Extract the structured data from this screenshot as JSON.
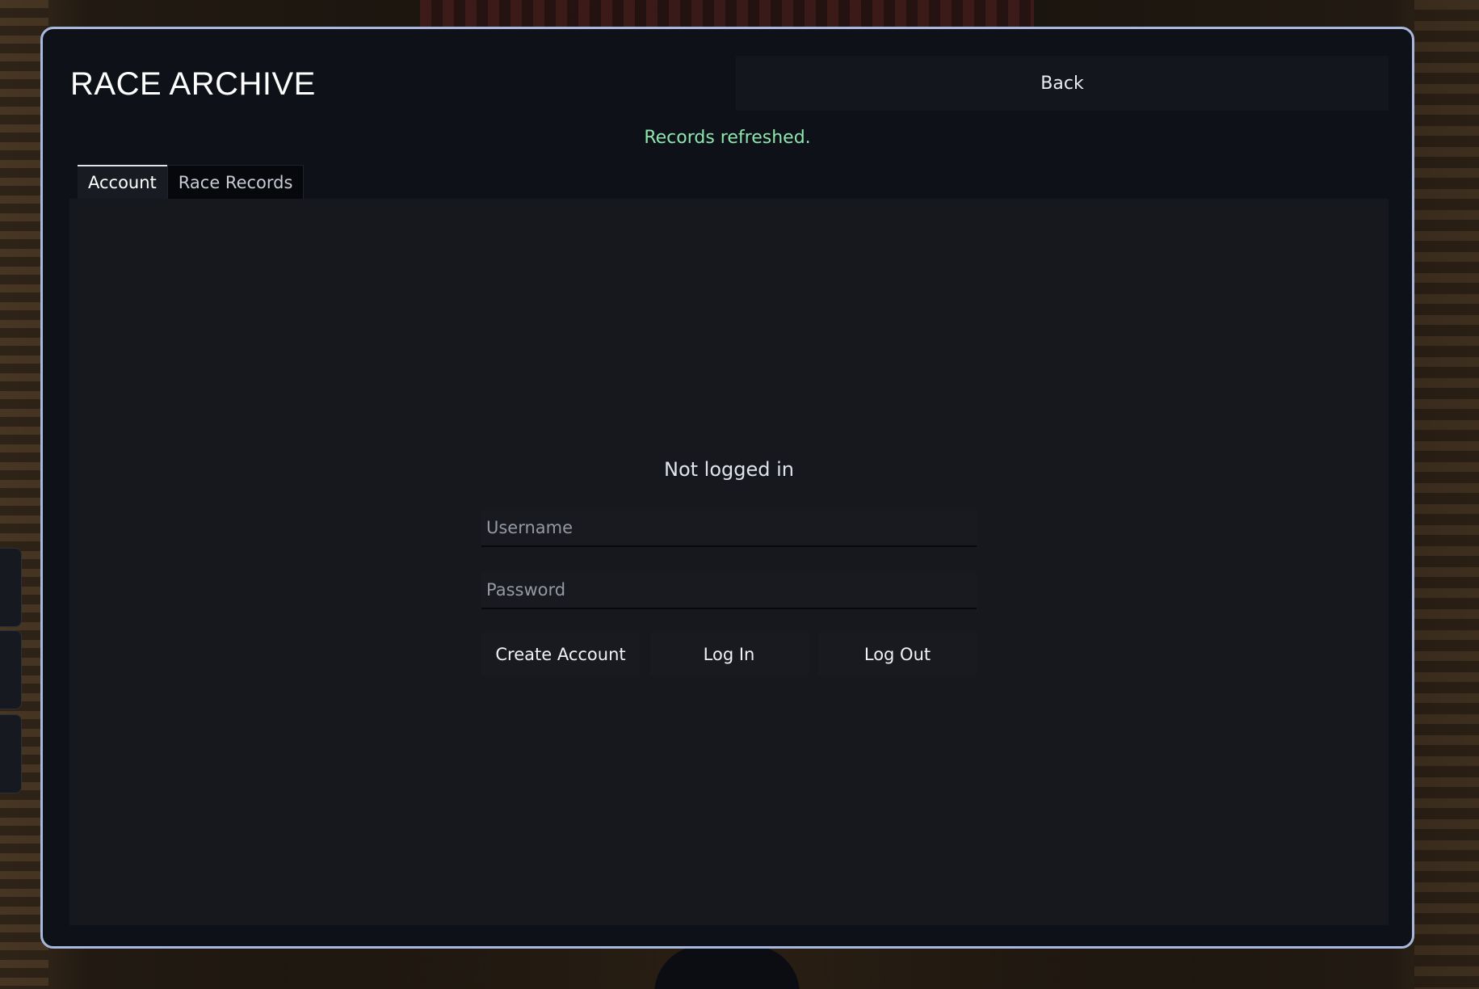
{
  "panel": {
    "title": "RACE ARCHIVE",
    "back_label": "Back",
    "status_message": "Records refreshed.",
    "status_color": "#8ee6ae",
    "border_color": "#a9b9dd"
  },
  "tabs": [
    {
      "label": "Account",
      "active": true
    },
    {
      "label": "Race Records",
      "active": false
    }
  ],
  "account": {
    "heading": "Not logged in",
    "username": {
      "value": "",
      "placeholder": "Username"
    },
    "password": {
      "value": "",
      "placeholder": "Password"
    },
    "buttons": {
      "create": "Create Account",
      "login": "Log In",
      "logout": "Log Out"
    }
  }
}
